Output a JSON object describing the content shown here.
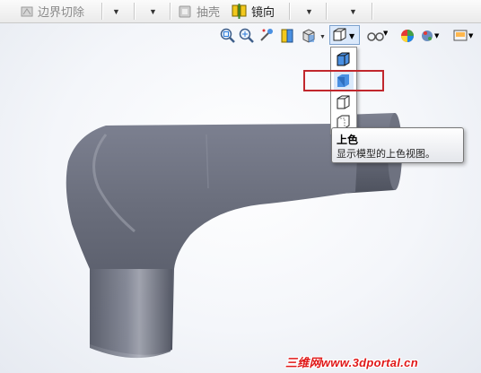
{
  "toolbar": {
    "boundary_cut_label": "边界切除",
    "shell_label": "抽壳",
    "mirror_label": "镜向",
    "dropdown_arrow": "▼"
  },
  "view_toolbar": {
    "icons": [
      "zoom-to-fit-icon",
      "zoom-area-icon",
      "previous-view-icon",
      "section-view-icon",
      "view-orientation-icon",
      "display-style-icon",
      "hide-show-items-icon",
      "edit-appearance-icon",
      "apply-scene-icon",
      "view-settings-icon"
    ]
  },
  "display_style_menu": {
    "items": [
      "shaded-with-edges",
      "shaded",
      "hidden-lines-removed",
      "hidden-lines-visible"
    ],
    "highlighted": "shaded"
  },
  "tooltip": {
    "title": "上色",
    "description": "显示模型的上色视图。"
  },
  "colors": {
    "highlight_border": "#c1272d",
    "model_body": "#6b6f7d",
    "watermark": "#e01818"
  },
  "watermark": "三维网www.3dportal.cn"
}
